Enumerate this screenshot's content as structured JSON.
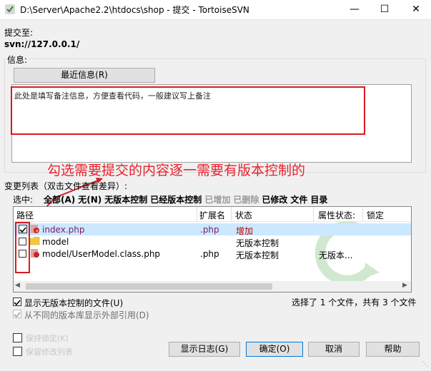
{
  "window": {
    "title": "D:\\Server\\Apache2.2\\htdocs\\shop - 提交 - TortoiseSVN"
  },
  "commit_to": {
    "label": "提交至:",
    "url": "svn://127.0.0.1/"
  },
  "message": {
    "group_label": "信息:",
    "recent_button": "最近信息(R)",
    "text": "此处是填写备注信息，方便查看代码，一般建议写上备注"
  },
  "annotation": "勾选需要提交的内容逐一需要有版本控制的",
  "changes": {
    "group_label": "变更列表（双击文件查看差异）:",
    "select_label": "选中:",
    "filters": [
      {
        "label": "全部(A)",
        "disabled": false
      },
      {
        "label": "无(N)",
        "disabled": false
      },
      {
        "label": "无版本控制",
        "disabled": false
      },
      {
        "label": "已经版本控制",
        "disabled": false
      },
      {
        "label": "已增加",
        "disabled": true
      },
      {
        "label": "已删除",
        "disabled": true
      },
      {
        "label": "已修改",
        "disabled": false
      },
      {
        "label": "文件",
        "disabled": false
      },
      {
        "label": "目录",
        "disabled": false
      }
    ],
    "columns": [
      "路径",
      "扩展名",
      "状态",
      "属性状态:",
      "锁定"
    ],
    "rows": [
      {
        "path": "index.php",
        "ext": ".php",
        "status": "增加",
        "prop": "",
        "checked": true,
        "icon": "php-file-added-icon"
      },
      {
        "path": "model",
        "ext": "",
        "status": "无版本控制",
        "prop": "",
        "checked": false,
        "icon": "folder-icon"
      },
      {
        "path": "model/UserModel.class.php",
        "ext": ".php",
        "status": "无版本控制",
        "prop": "无版本...",
        "checked": false,
        "icon": "php-file-icon"
      }
    ],
    "show_unversioned": "显示无版本控制的文件(U)",
    "show_externals": "从不同的版本库显示外部引用(D)",
    "selection_status": "选择了 1 个文件，共有 3 个文件"
  },
  "bottom": {
    "keep_locks": "保持锁定(K)",
    "keep_changelists": "保留修改列表",
    "buttons": {
      "log": "显示日志(G)",
      "ok": "确定(O)",
      "cancel": "取消",
      "help": "帮助"
    }
  },
  "colors": {
    "annotation": "#e8222d",
    "added_text": "#c00000",
    "selected_row": "#cce8ff"
  }
}
